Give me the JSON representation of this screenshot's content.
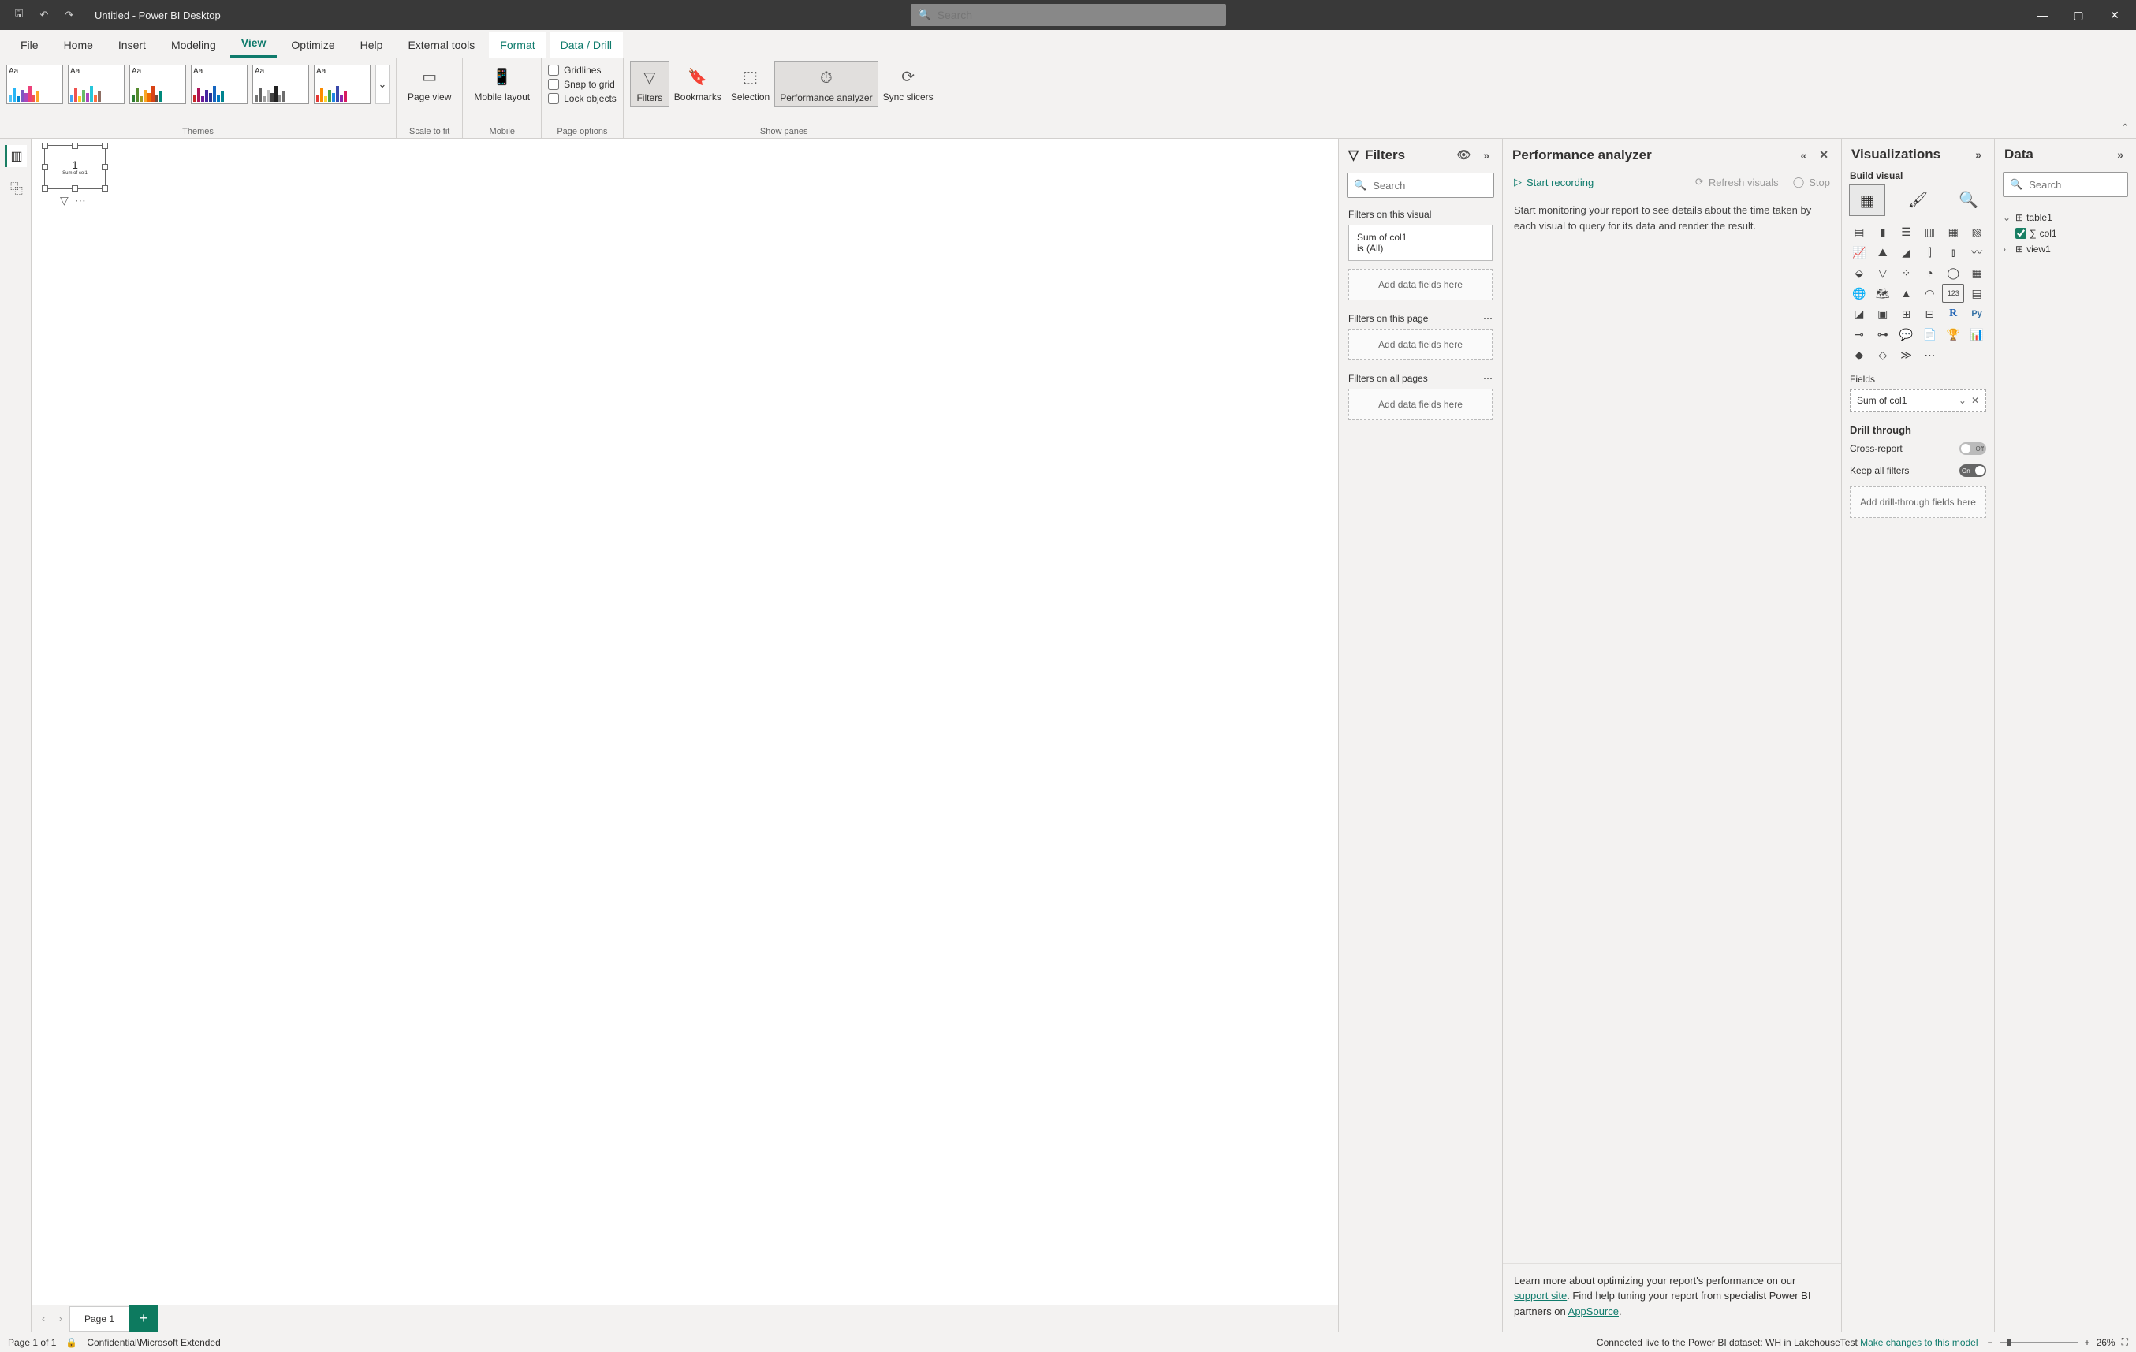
{
  "titlebar": {
    "title": "Untitled - Power BI Desktop",
    "search_placeholder": "Search"
  },
  "tabs": [
    "File",
    "Home",
    "Insert",
    "Modeling",
    "View",
    "Optimize",
    "Help",
    "External tools",
    "Format",
    "Data / Drill"
  ],
  "active_tab": "View",
  "contextual_tabs": [
    "Format",
    "Data / Drill"
  ],
  "ribbon": {
    "themes_label": "Themes",
    "scale_label": "Scale to fit",
    "page_view": "Page view",
    "mobile_label": "Mobile",
    "mobile_layout": "Mobile layout",
    "page_options_label": "Page options",
    "gridlines": "Gridlines",
    "snap": "Snap to grid",
    "lock": "Lock objects",
    "show_panes_label": "Show panes",
    "filters_btn": "Filters",
    "bookmarks_btn": "Bookmarks",
    "selection_btn": "Selection",
    "perf_btn": "Performance analyzer",
    "sync_btn": "Sync slicers"
  },
  "filters_pane": {
    "title": "Filters",
    "search_placeholder": "Search",
    "sec_visual": "Filters on this visual",
    "card_title": "Sum of col1",
    "card_sub": "is (All)",
    "drop_text": "Add data fields here",
    "sec_page": "Filters on this page",
    "sec_all": "Filters on all pages"
  },
  "perf_pane": {
    "title": "Performance analyzer",
    "start": "Start recording",
    "refresh": "Refresh visuals",
    "stop": "Stop",
    "body": "Start monitoring your report to see details about the time taken by each visual to query for its data and render the result.",
    "footer1": "Learn more about optimizing your report's performance on our ",
    "support": "support site",
    "footer2": ". Find help tuning your report from specialist Power BI partners on ",
    "appsource": "AppSource",
    "footer3": "."
  },
  "viz_pane": {
    "title": "Visualizations",
    "subtitle": "Build visual",
    "fields_label": "Fields",
    "field_chip": "Sum of col1",
    "drill_label": "Drill through",
    "cross": "Cross-report",
    "cross_state": "Off",
    "keep": "Keep all filters",
    "keep_state": "On",
    "drill_drop": "Add drill-through fields here"
  },
  "data_pane": {
    "title": "Data",
    "search_placeholder": "Search",
    "table": "table1",
    "col": "col1",
    "view": "view1"
  },
  "canvas": {
    "value": "1",
    "caption": "Sum of col1"
  },
  "page_tabs": {
    "page": "Page 1"
  },
  "status": {
    "page": "Page 1 of 1",
    "class": "Confidential\\Microsoft Extended",
    "conn": "Connected live to the Power BI dataset: WH in LakehouseTest ",
    "link": "Make changes to this model",
    "zoom": "26%"
  }
}
